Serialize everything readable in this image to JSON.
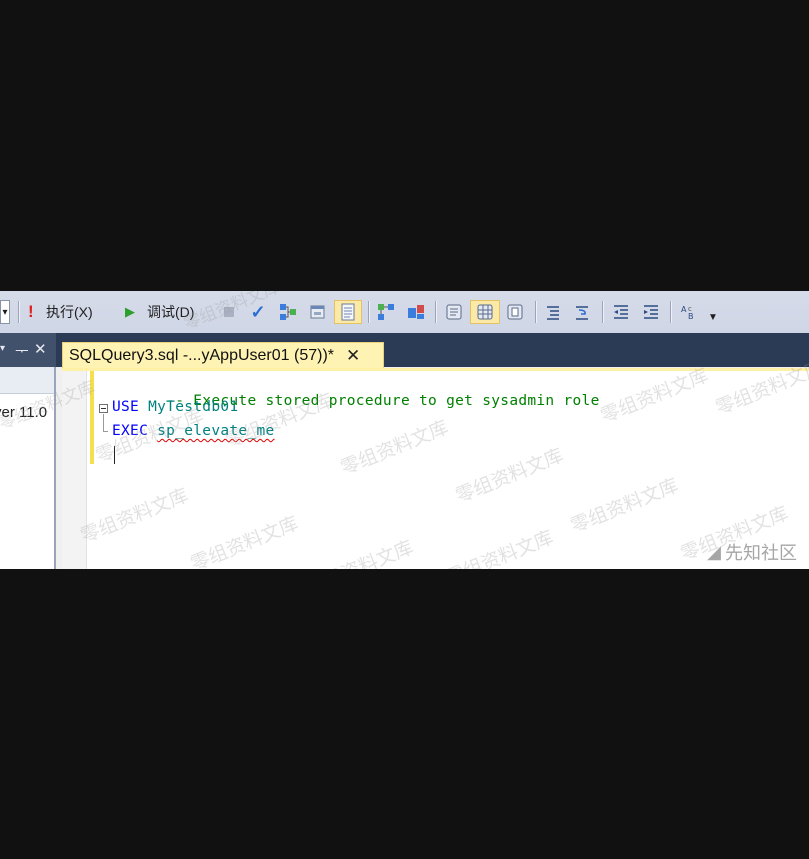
{
  "toolbar": {
    "execute_label": "执行(X)",
    "debug_label": "调试(D)"
  },
  "left_panel": {
    "pin_glyph": "ᅮ",
    "close_glyph": "✕",
    "server_text": "ver 11.0"
  },
  "tab": {
    "title": "SQLQuery3.sql -...yAppUser01 (57))*",
    "close_glyph": "✕"
  },
  "editor": {
    "lines": [
      {
        "comment": "-- Execute stored procedure to get sysadmin role"
      },
      {
        "keyword": "USE",
        "identifier": "MyTestdb01"
      },
      {
        "keyword": "EXEC",
        "identifier": "sp_elevate_me"
      }
    ]
  },
  "watermark": {
    "text": "零组资料文库",
    "brand": "先知社区"
  },
  "colors": {
    "keyword": "#0000ff",
    "comment": "#008000",
    "identifier": "#008080",
    "tab_active": "#fff3b3",
    "tabstrip": "#2b3a55"
  }
}
